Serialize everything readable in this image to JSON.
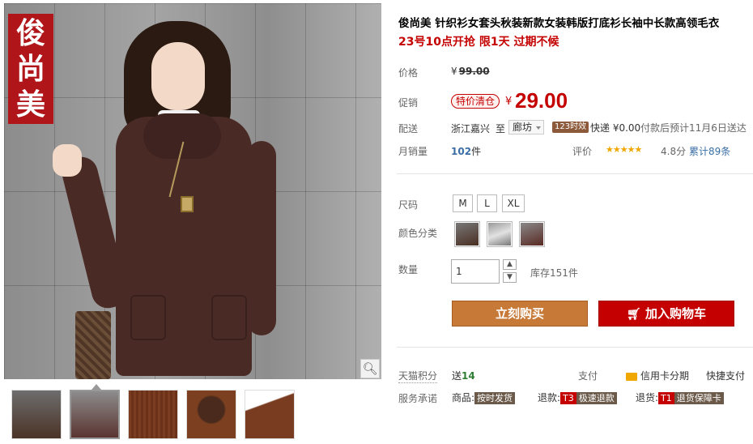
{
  "gallery": {
    "brand_logo": "俊尚美",
    "zoom_icon": "magnifier-icon",
    "thumbnails": [
      "thumb-1",
      "thumb-2",
      "thumb-3",
      "thumb-4",
      "thumb-5"
    ],
    "active_thumb": 1
  },
  "product": {
    "title": "俊尚美 针织衫女套头秋装新款女装韩版打底衫长袖中长款高领毛衣",
    "promo": "23号10点开抢 限1天 过期不候"
  },
  "pricing": {
    "list_label": "价格",
    "list_currency": "¥",
    "list_price": "99.00",
    "promo_label": "促销",
    "promo_badge": "特价清仓",
    "promo_currency": "¥",
    "promo_price": "29.00"
  },
  "shipping": {
    "label": "配送",
    "from": "浙江嘉兴",
    "to_word": "至",
    "destination": "廊坊",
    "time_badge": "123时效",
    "express": "快递 ¥0.00",
    "eta": "付款后预计11月6日送达"
  },
  "sales": {
    "label": "月销量",
    "count": "102",
    "unit": "件",
    "rating_label": "评价",
    "stars": "★★★★★",
    "score": "4.8分",
    "reviews": "累计89条"
  },
  "options": {
    "size_label": "尺码",
    "sizes": [
      "M",
      "L",
      "XL"
    ],
    "color_label": "颜色分类",
    "colors": [
      "#4a2e22",
      "#b8b8b8",
      "#5a2a24"
    ],
    "qty_label": "数量",
    "qty_value": "1",
    "qty_up": "▲",
    "qty_down": "▼",
    "stock": "库存151件"
  },
  "actions": {
    "buy_now": "立刻购买",
    "add_to_cart": "加入购物车",
    "cart_icon": "cart-icon"
  },
  "footer": {
    "points_label": "天猫积分",
    "points_give": "送",
    "points_value": "14",
    "pay_label": "支付",
    "credit_installment": "信用卡分期",
    "express_pay": "快捷支付",
    "promise_label": "服务承诺",
    "goods_label": "商品:",
    "goods_tag": "按时发货",
    "refund_label": "退款:",
    "refund_code": "T3",
    "refund_tag": "极速退款",
    "return_label": "退货:",
    "return_code": "T1",
    "return_tag": "退货保障卡"
  }
}
